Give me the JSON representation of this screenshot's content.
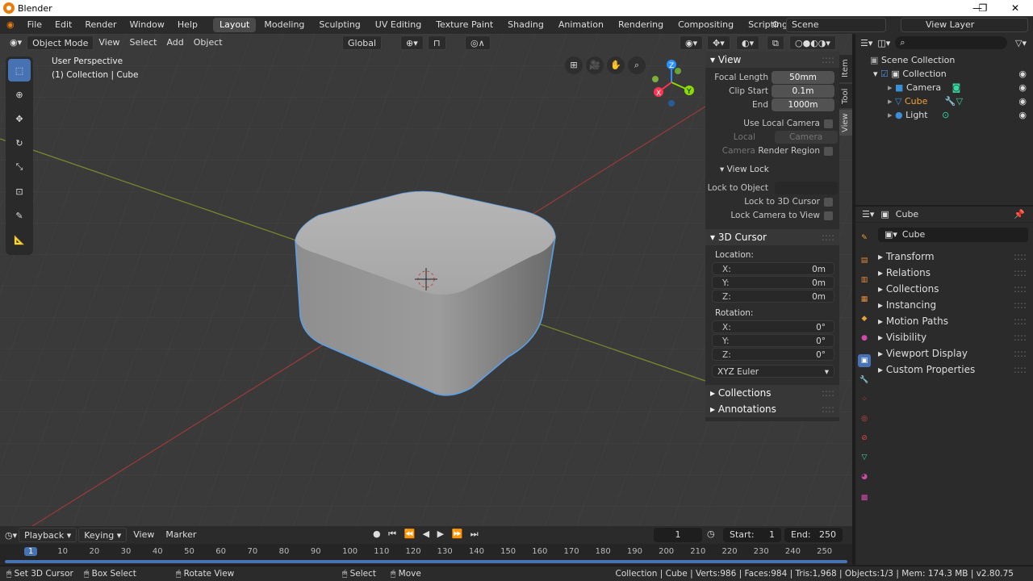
{
  "window": {
    "title": "Blender"
  },
  "menu": [
    "File",
    "Edit",
    "Render",
    "Window",
    "Help"
  ],
  "workspaces": [
    {
      "label": "Layout",
      "active": true
    },
    {
      "label": "Modeling"
    },
    {
      "label": "Sculpting"
    },
    {
      "label": "UV Editing"
    },
    {
      "label": "Texture Paint"
    },
    {
      "label": "Shading"
    },
    {
      "label": "Animation"
    },
    {
      "label": "Rendering"
    },
    {
      "label": "Compositing"
    },
    {
      "label": "Scripting"
    }
  ],
  "scene": {
    "name": "Scene",
    "view_layer": "View Layer"
  },
  "viewport": {
    "mode": "Object Mode",
    "menus": [
      "View",
      "Select",
      "Add",
      "Object"
    ],
    "orientation": "Global",
    "overlay_title": "User Perspective",
    "overlay_subtitle": "(1) Collection | Cube",
    "gizmo": {
      "x": "X",
      "y": "Y",
      "z": "Z"
    }
  },
  "npanel": {
    "tabs": [
      "Item",
      "Tool",
      "View"
    ],
    "view_header": "View",
    "focal_length_label": "Focal Length",
    "focal_length": "50mm",
    "clip_start_label": "Clip Start",
    "clip_start": "0.1m",
    "end_label": "End",
    "end": "1000m",
    "use_local_camera": "Use Local Camera",
    "local_camera_label": "Local Camera",
    "local_camera": "Camera",
    "render_region": "Render Region",
    "view_lock_header": "View Lock",
    "lock_to_object": "Lock to Object",
    "lock_to_cursor": "Lock to 3D Cursor",
    "lock_camera": "Lock Camera to View",
    "cursor_header": "3D Cursor",
    "location_label": "Location:",
    "loc": [
      {
        "k": "X:",
        "v": "0m"
      },
      {
        "k": "Y:",
        "v": "0m"
      },
      {
        "k": "Z:",
        "v": "0m"
      }
    ],
    "rotation_label": "Rotation:",
    "rot": [
      {
        "k": "X:",
        "v": "0°"
      },
      {
        "k": "Y:",
        "v": "0°"
      },
      {
        "k": "Z:",
        "v": "0°"
      }
    ],
    "rotation_mode": "XYZ Euler",
    "collections_header": "Collections",
    "annotations_header": "Annotations"
  },
  "outliner": {
    "scene_collection": "Scene Collection",
    "collection": "Collection",
    "items": [
      "Camera",
      "Cube",
      "Light"
    ]
  },
  "properties": {
    "object_name": "Cube",
    "name_field": "Cube",
    "sections": [
      "Transform",
      "Relations",
      "Collections",
      "Instancing",
      "Motion Paths",
      "Visibility",
      "Viewport Display",
      "Custom Properties"
    ]
  },
  "timeline": {
    "menus": [
      "Playback",
      "Keying",
      "View",
      "Marker"
    ],
    "current_frame": "1",
    "start_label": "Start:",
    "start": "1",
    "end_label": "End:",
    "end": "250",
    "ticks": [
      "1",
      "10",
      "20",
      "30",
      "40",
      "50",
      "60",
      "70",
      "80",
      "90",
      "100",
      "110",
      "120",
      "130",
      "140",
      "150",
      "160",
      "170",
      "180",
      "190",
      "200",
      "210",
      "220",
      "230",
      "240",
      "250"
    ]
  },
  "status": {
    "hints": [
      "Set 3D Cursor",
      "Box Select",
      "Rotate View",
      "Select",
      "Move"
    ],
    "info": "Collection | Cube | Verts:986 | Faces:984 | Tris:1,968 | Objects:1/3 | Mem: 174.3 MB | v2.80.75"
  },
  "colors": {
    "accent": "#4772b3",
    "selected_outline": "#5aa0e8",
    "x_axis": "#ff3352",
    "y_axis": "#8bdc00",
    "z_axis": "#2890ff"
  }
}
